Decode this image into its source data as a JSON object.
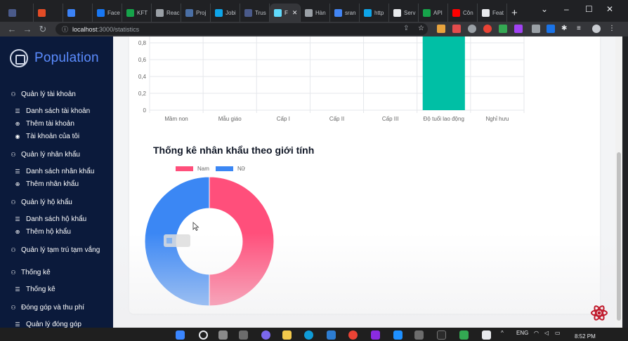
{
  "browser": {
    "tabs": [
      {
        "label": "",
        "color": "#4a5a8a"
      },
      {
        "label": "",
        "color": "#e34c26"
      },
      {
        "label": "",
        "color": "#3b82f6"
      },
      {
        "label": "Face",
        "color": "#1877f2"
      },
      {
        "label": "KFT",
        "color": "#16a34a"
      },
      {
        "label": "Reac",
        "color": "#9aa0a6"
      },
      {
        "label": "Proj",
        "color": "#4a6fa5"
      },
      {
        "label": "Jobi",
        "color": "#0ea5e9"
      },
      {
        "label": "Trus",
        "color": "#4a5a8a"
      },
      {
        "label": "F",
        "color": "#61dafb",
        "active": true
      },
      {
        "label": "Hàn",
        "color": "#9aa0a6"
      },
      {
        "label": "sran",
        "color": "#4285f4"
      },
      {
        "label": "http",
        "color": "#0ea5e9"
      },
      {
        "label": "Serv",
        "color": "#e8eaed"
      },
      {
        "label": "API",
        "color": "#16a34a"
      },
      {
        "label": "Côn",
        "color": "#ff0000"
      },
      {
        "label": "Feat",
        "color": "#e8eaed"
      }
    ],
    "url_host": "localhost",
    "url_path": ":3000/statistics"
  },
  "sidebar": {
    "brand": "Population",
    "groups": [
      {
        "label": "Quản lý tài khoản",
        "items": [
          "Danh sách tài khoản",
          "Thêm tài khoản",
          "Tài khoản của tôi"
        ]
      },
      {
        "label": "Quản lý nhân khẩu",
        "items": [
          "Danh sách nhân khẩu",
          "Thêm nhân khẩu"
        ]
      },
      {
        "label": "Quản lý hộ khẩu",
        "items": [
          "Danh sách hộ khẩu",
          "Thêm hộ khẩu"
        ]
      },
      {
        "label": "Quản lý tạm trú tạm vắng",
        "items": []
      },
      {
        "label": "Thống kê",
        "items": [
          "Thống kê"
        ]
      },
      {
        "label": "Đóng góp và thu phí",
        "items": [
          "Quản lý đóng góp"
        ]
      }
    ]
  },
  "chart_data": [
    {
      "type": "bar",
      "categories": [
        "Mầm non",
        "Mẫu giáo",
        "Cấp I",
        "Cấp II",
        "Cấp III",
        "Độ tuổi lao động",
        "Nghỉ hưu"
      ],
      "values": [
        0,
        0,
        0,
        0,
        0,
        1,
        0
      ],
      "ylim": [
        0,
        1
      ],
      "yticks": [
        "0",
        "0,2",
        "0,4",
        "0,6",
        "0,8"
      ],
      "colors": [
        "#00bfa5"
      ],
      "grid": true
    },
    {
      "type": "pie",
      "donut": true,
      "title": "Thống kê nhân khẩu theo giới tính",
      "labels": [
        "Nam",
        "Nữ"
      ],
      "values": [
        1,
        1
      ],
      "colors": [
        "#ff4f7b",
        "#3b87f4"
      ],
      "legend": "top"
    }
  ],
  "taskbar": {
    "lang": "ENG",
    "time": "8:52 PM"
  }
}
